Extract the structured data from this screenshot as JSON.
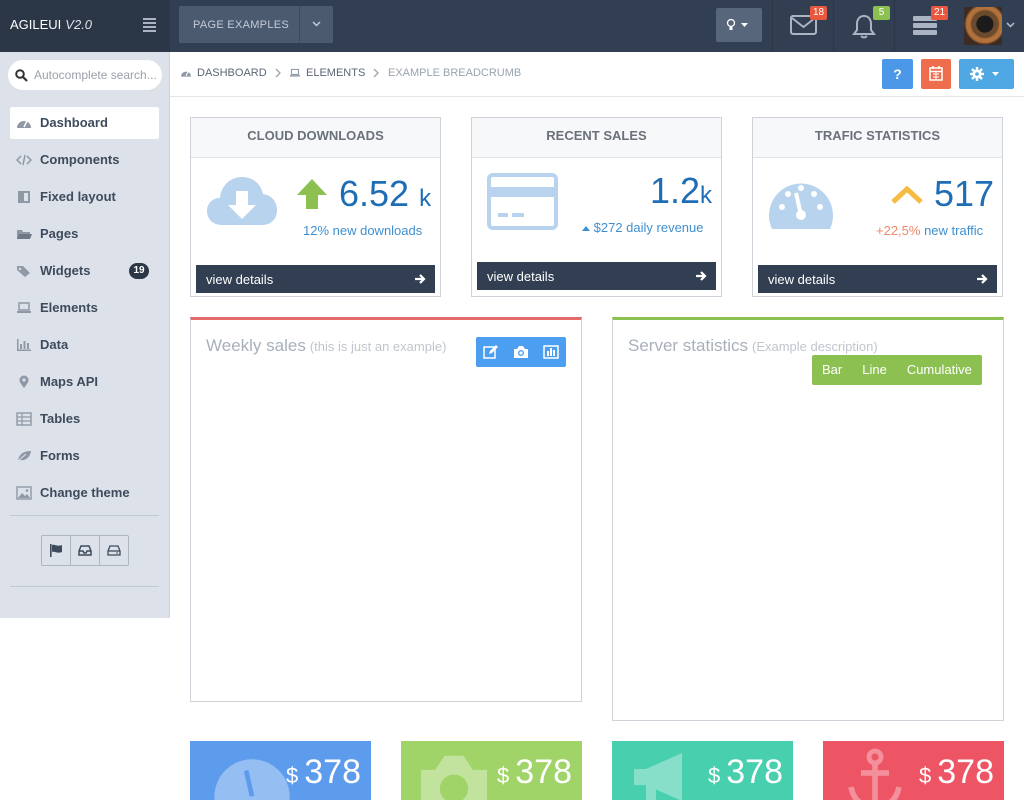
{
  "brand": {
    "name": "AGILEUI",
    "version": "V2.0"
  },
  "header": {
    "page_examples_label": "PAGE EXAMPLES",
    "messages_count": "18",
    "notifications_count": "5",
    "tasks_count": "21"
  },
  "sidebar": {
    "search_placeholder": "Autocomplete search...",
    "items": [
      {
        "label": "Dashboard",
        "icon": "dashboard-icon"
      },
      {
        "label": "Components",
        "icon": "code-icon"
      },
      {
        "label": "Fixed layout",
        "icon": "layout-icon"
      },
      {
        "label": "Pages",
        "icon": "folder-icon"
      },
      {
        "label": "Widgets",
        "icon": "tags-icon",
        "badge": "19"
      },
      {
        "label": "Elements",
        "icon": "laptop-icon"
      },
      {
        "label": "Data",
        "icon": "bar-chart-icon"
      },
      {
        "label": "Maps API",
        "icon": "map-marker-icon"
      },
      {
        "label": "Tables",
        "icon": "table-icon"
      },
      {
        "label": "Forms",
        "icon": "leaf-icon"
      },
      {
        "label": "Change theme",
        "icon": "image-icon"
      }
    ]
  },
  "breadcrumb": {
    "items": [
      "DASHBOARD",
      "ELEMENTS",
      "EXAMPLE BREADCRUMB"
    ],
    "help_label": "?"
  },
  "cards": [
    {
      "title": "CLOUD DOWNLOADS",
      "value": "6.52",
      "unit": "k",
      "subtitle": "12% new downloads",
      "details": "view details"
    },
    {
      "title": "RECENT SALES",
      "value": "1.2",
      "unit": "k",
      "subtitle": "$272 daily revenue",
      "details": "view details"
    },
    {
      "title": "TRAFIC STATISTICS",
      "value": "517",
      "subtitle_highlight": "+22,5%",
      "subtitle": "new traffic",
      "details": "view details"
    }
  ],
  "panels": {
    "weekly": {
      "title": "Weekly sales",
      "description": "(this is just an example)"
    },
    "server": {
      "title": "Server statistics",
      "description": "(Example description)",
      "modes": [
        "Bar",
        "Line",
        "Cumulative"
      ]
    }
  },
  "tiles": [
    {
      "currency": "$",
      "value": "378",
      "color": "#5d9cec"
    },
    {
      "currency": "$",
      "value": "378",
      "color": "#a0d468"
    },
    {
      "currency": "$",
      "value": "378",
      "color": "#48cfad"
    },
    {
      "currency": "$",
      "value": "378",
      "color": "#ed5565"
    }
  ],
  "colors": {
    "topbar": "#323e51",
    "sidebar": "#dde2ea",
    "accent_blue": "#1f6db5",
    "accent_green": "#8cc152",
    "accent_red": "#e56a6a"
  }
}
